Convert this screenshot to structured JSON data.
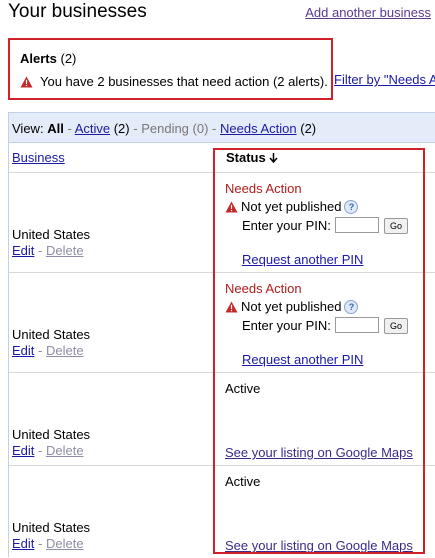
{
  "page": {
    "title": "Your businesses",
    "add_link": "Add another business"
  },
  "alerts": {
    "title": "Alerts",
    "count": "(2)",
    "message": "You have 2 businesses that need action (2 alerts).",
    "filter_link": "Filter by \"Needs A"
  },
  "view": {
    "label": "View:",
    "all": "All",
    "active_label": "Active",
    "active_count": "(2)",
    "pending": "Pending (0)",
    "needs_label": "Needs Action",
    "needs_count": "(2)"
  },
  "columns": {
    "business": "Business",
    "status": "Status",
    "sort_icon": "sort-descending-icon"
  },
  "rows": [
    {
      "country": "United States",
      "edit": "Edit",
      "delete": "Delete",
      "status": "Needs Action",
      "sub_status": "Not yet published",
      "pin_label": "Enter your PIN:",
      "go": "Go",
      "link": "Request another PIN"
    },
    {
      "country": "United States",
      "edit": "Edit",
      "delete": "Delete",
      "status": "Needs Action",
      "sub_status": "Not yet published",
      "pin_label": "Enter your PIN:",
      "go": "Go",
      "link": "Request another PIN"
    },
    {
      "country": "United States",
      "edit": "Edit",
      "delete": "Delete",
      "status": "Active",
      "link": "See your listing on Google Maps"
    },
    {
      "country": "United States",
      "edit": "Edit",
      "delete": "Delete",
      "status": "Active",
      "link": "See your listing on Google Maps"
    }
  ],
  "colors": {
    "alert_border": "#d0202a",
    "needs_action": "#b31b1b",
    "link": "#1a1aa6",
    "header_bg": "#e5ecf9"
  }
}
